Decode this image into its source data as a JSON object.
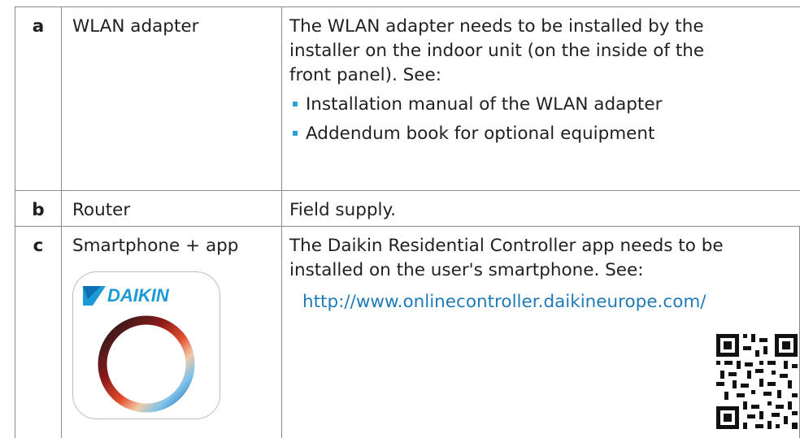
{
  "rows": [
    {
      "key": "a",
      "name": "WLAN adapter",
      "desc_lines": [
        "The WLAN adapter needs to be installed by the",
        "installer on the indoor unit (on the inside of the",
        "front panel). See:"
      ],
      "bullets": [
        "Installation manual of the WLAN adapter",
        "Addendum book for optional equipment"
      ]
    },
    {
      "key": "b",
      "name": "Router",
      "desc": "Field supply."
    },
    {
      "key": "c",
      "name": "Smartphone + app",
      "desc_lines": [
        "The Daikin Residential Controller app needs to be",
        "installed on the user's smartphone. See:"
      ],
      "link": "http://www.onlinecontroller.daikineurope.com/",
      "app_logo_text": "DAIKIN"
    }
  ],
  "colors": {
    "bullet": "#2e9fd8",
    "link": "#1f7ab8",
    "daikin_blue": "#1b9ad6",
    "border": "#8a8a8a"
  }
}
